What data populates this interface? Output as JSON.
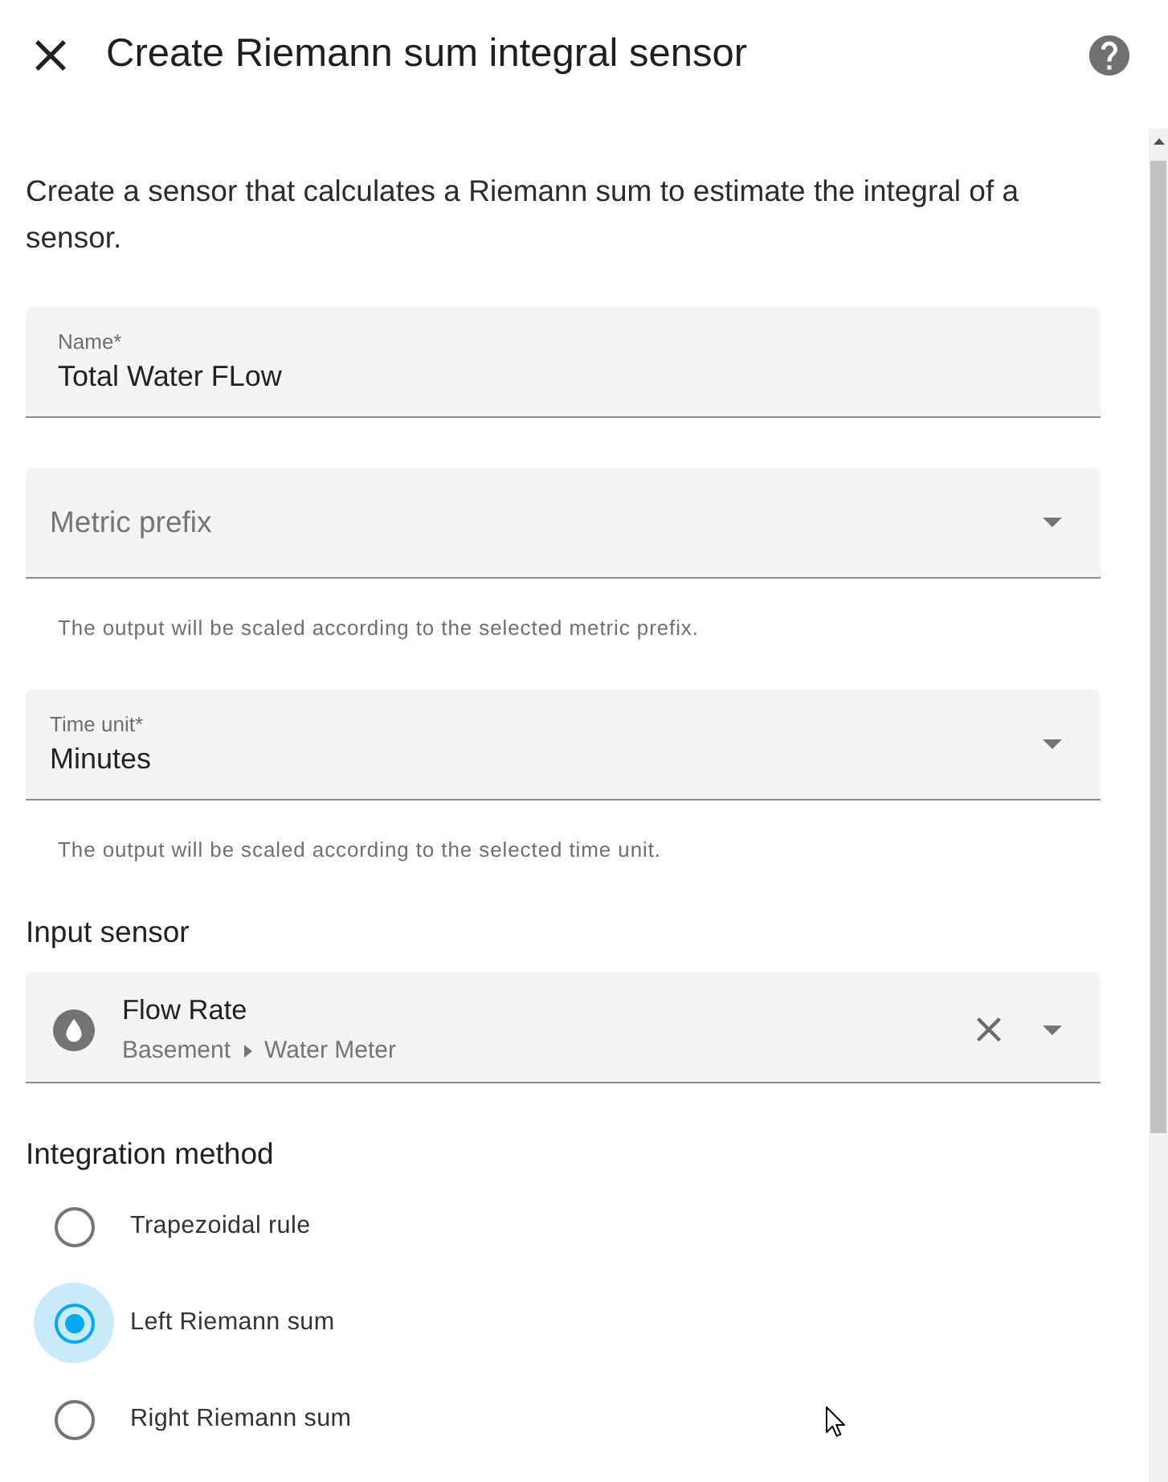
{
  "dialog": {
    "title": "Create Riemann sum integral sensor"
  },
  "description": "Create a sensor that calculates a Riemann sum to estimate the integral of a sensor.",
  "fields": [
    {
      "kind": "text",
      "label": "Name*",
      "value": "Total Water FLow"
    },
    {
      "kind": "select",
      "placeholder": "Metric prefix",
      "helper": "The output will be scaled according to the selected metric prefix."
    },
    {
      "kind": "select",
      "label": "Time unit*",
      "value": "Minutes",
      "helper": "The output will be scaled according to the selected time unit."
    }
  ],
  "input_sensor": {
    "heading": "Input sensor",
    "entity": {
      "name": "Flow Rate",
      "area": "Basement",
      "device": "Water Meter"
    }
  },
  "integration_method": {
    "heading": "Integration method",
    "options": [
      {
        "label": "Trapezoidal rule",
        "selected": false
      },
      {
        "label": "Left Riemann sum",
        "selected": true
      },
      {
        "label": "Right Riemann sum",
        "selected": false
      }
    ]
  }
}
